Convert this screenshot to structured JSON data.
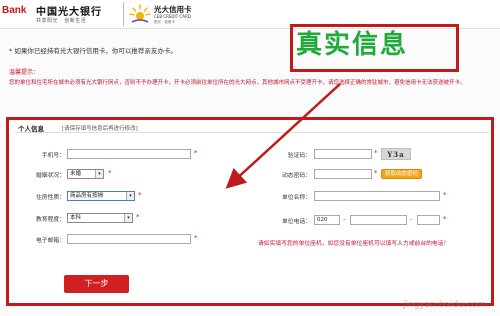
{
  "header": {
    "bank_logo_text": "Bank",
    "bank_name": "中国光大银行",
    "bank_slogan": "共享阳光 · 创新生活",
    "card_name": "光大信用卡",
    "card_name_en": "CEB CREDIT CARD",
    "card_sub": "阳光 · 信用卡"
  },
  "intro": "* 如果你已经持有光大银行信用卡，你可以推荐亲友办卡。",
  "tips": {
    "title": "温馨提示：",
    "body": "您的单位和住宅所在城市必须有光大银行网点，否则不予办理开卡，开卡必须前往单位所在的光大网点，其他城市网点不受理开卡，请您选择正确的常驻城市，避免信用卡无法获送被开卡。"
  },
  "annotation": {
    "text": "真实信息",
    "text_color": "#1faa3a",
    "box_color": "#c01a1a"
  },
  "form": {
    "section_title": "个人信息",
    "section_note": "[请保存填写信息后再进行修改]",
    "phone": {
      "label": "手机号：",
      "value": ""
    },
    "marital": {
      "label": "婚姻状况：",
      "value": "未婚"
    },
    "housing": {
      "label": "住房性质：",
      "value": "商品房有按揭"
    },
    "education": {
      "label": "教育程度：",
      "value": "本科"
    },
    "email": {
      "label": "电子邮箱：",
      "value": ""
    },
    "captcha": {
      "label": "验证码：",
      "value": "",
      "image_text": "Y3a"
    },
    "dynamic_code": {
      "label": "动态密码：",
      "value": "",
      "button": "获取动态密码"
    },
    "company": {
      "label": "单位名称：",
      "value": ""
    },
    "company_phone": {
      "label": "单位电话：",
      "area_code": "020",
      "number": "",
      "ext": ""
    },
    "note": "请如实填写您的单位座机，如您没有单位座机可以填写人力或前台的电话！",
    "next_button": "下一步"
  },
  "watermark": "jingyan.baidu.com"
}
